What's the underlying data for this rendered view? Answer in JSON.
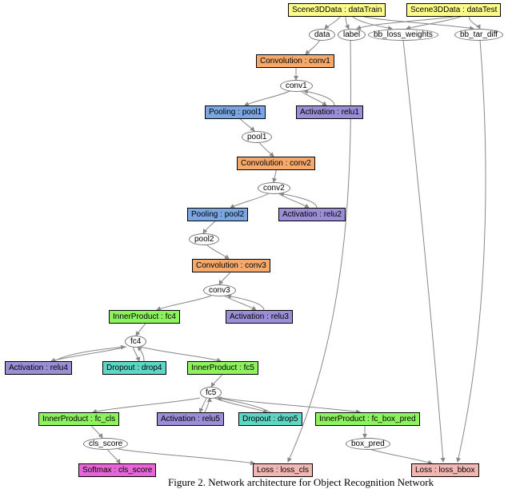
{
  "nodes": {
    "dataTrain": "Scene3DData : dataTrain",
    "dataTest": "Scene3DData : dataTest",
    "data": "data",
    "label": "label",
    "bb_loss_weights": "bb_loss_weights",
    "bb_tar_diff": "bb_tar_diff",
    "conv1_layer": "Convolution : conv1",
    "conv1": "conv1",
    "pool1_layer": "Pooling : pool1",
    "relu1_layer": "Activation : relu1",
    "pool1": "pool1",
    "conv2_layer": "Convolution : conv2",
    "conv2": "conv2",
    "pool2_layer": "Pooling : pool2",
    "relu2_layer": "Activation : relu2",
    "pool2": "pool2",
    "conv3_layer": "Convolution : conv3",
    "conv3": "conv3",
    "fc4_layer": "InnerProduct : fc4",
    "relu3_layer": "Activation : relu3",
    "fc4": "fc4",
    "relu4_layer": "Activation : relu4",
    "drop4_layer": "Dropout : drop4",
    "fc5_layer": "InnerProduct : fc5",
    "fc5": "fc5",
    "fc_cls_layer": "InnerProduct : fc_cls",
    "relu5_layer": "Activation : relu5",
    "drop5_layer": "Dropout : drop5",
    "fc_box_pred_layer": "InnerProduct : fc_box_pred",
    "cls_score": "cls_score",
    "box_pred": "box_pred",
    "softmax_layer": "Softmax : cls_score",
    "loss_cls_layer": "Loss : loss_cls",
    "loss_bbox_layer": "Loss : loss_bbox"
  },
  "caption": "Figure 2. Network architecture for Object Recognition Network"
}
